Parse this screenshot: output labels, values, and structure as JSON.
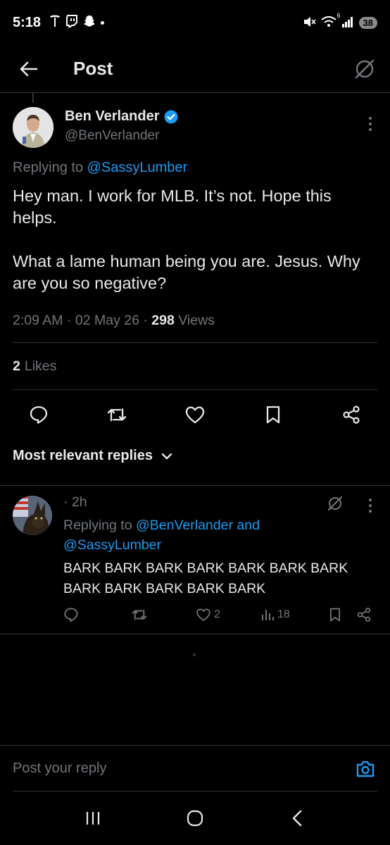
{
  "status_bar": {
    "time": "5:18",
    "network_badge": "6",
    "battery": "38"
  },
  "header": {
    "title": "Post"
  },
  "post": {
    "author_name": "Ben Verlander",
    "author_handle": "@BenVerlander",
    "replying_prefix": "Replying to",
    "replying_to": "@SassyLumber",
    "paragraph_1": "Hey man. I work for MLB. It’s not. Hope this helps.",
    "paragraph_2": "What a lame human being you are. Jesus. Why are you so negative?",
    "time": "2:09 AM",
    "date": "02 May 26",
    "views_count": "298",
    "views_label": "Views",
    "likes_count": "2",
    "likes_label": "Likes"
  },
  "replies_section": {
    "title": "Most relevant replies"
  },
  "reply": {
    "time": "· 2h",
    "replying_prefix": "Replying to",
    "replying_to_1": "@BenVerlander",
    "replying_and": "and",
    "replying_to_2": "@SassyLumber",
    "text": "BARK BARK BARK BARK BARK BARK BARK BARK BARK BARK BARK BARK",
    "like_count": "2",
    "view_count": "18"
  },
  "compose": {
    "placeholder": "Post your reply"
  },
  "colors": {
    "accent": "#1d9bf0",
    "background": "#000000",
    "muted": "#71767b",
    "text": "#e7e9ea",
    "divider": "#2f3336"
  }
}
